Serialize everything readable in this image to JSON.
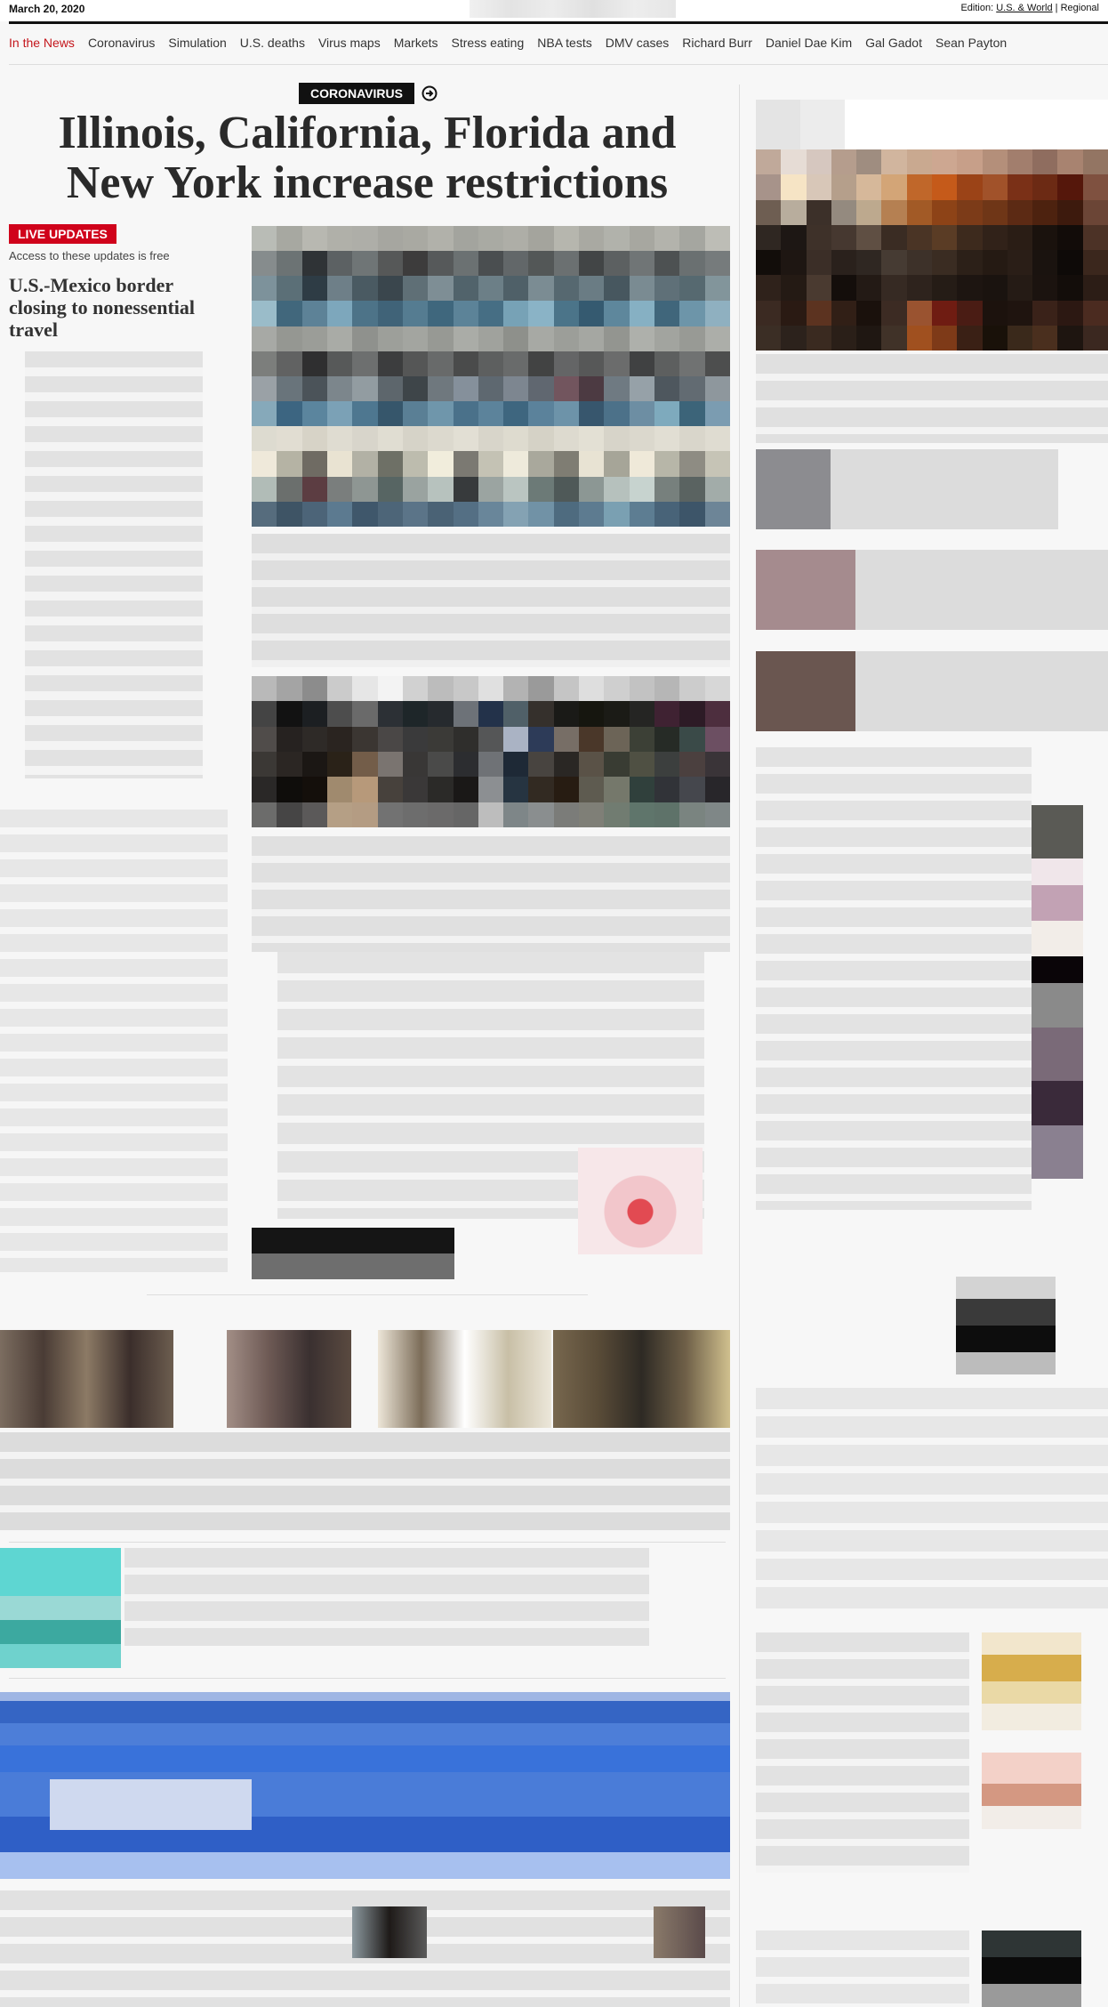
{
  "header": {
    "date": "March 20, 2020",
    "edition_label": "Edition:",
    "edition_options": [
      "U.S. & World",
      "Regional"
    ]
  },
  "nav": {
    "items": [
      "In the News",
      "Coronavirus",
      "Simulation",
      "U.S. deaths",
      "Virus maps",
      "Markets",
      "Stress eating",
      "NBA tests",
      "DMV cases",
      "Richard Burr",
      "Daniel Dae Kim",
      "Gal Gadot",
      "Sean Payton"
    ]
  },
  "lead": {
    "kicker": "CORONAVIRUS",
    "headline": "Illinois, California, Florida and New York increase restrictions"
  },
  "live": {
    "badge": "LIVE UPDATES",
    "access": "Access to these updates is free",
    "subhead": "U.S.-Mexico border closing to nonessential travel"
  },
  "colors": {
    "accent": "#c4161c",
    "badge": "#d0021b",
    "ink": "#111111"
  },
  "icons": {
    "kicker_arrow": "arrow-right-circle-icon"
  }
}
